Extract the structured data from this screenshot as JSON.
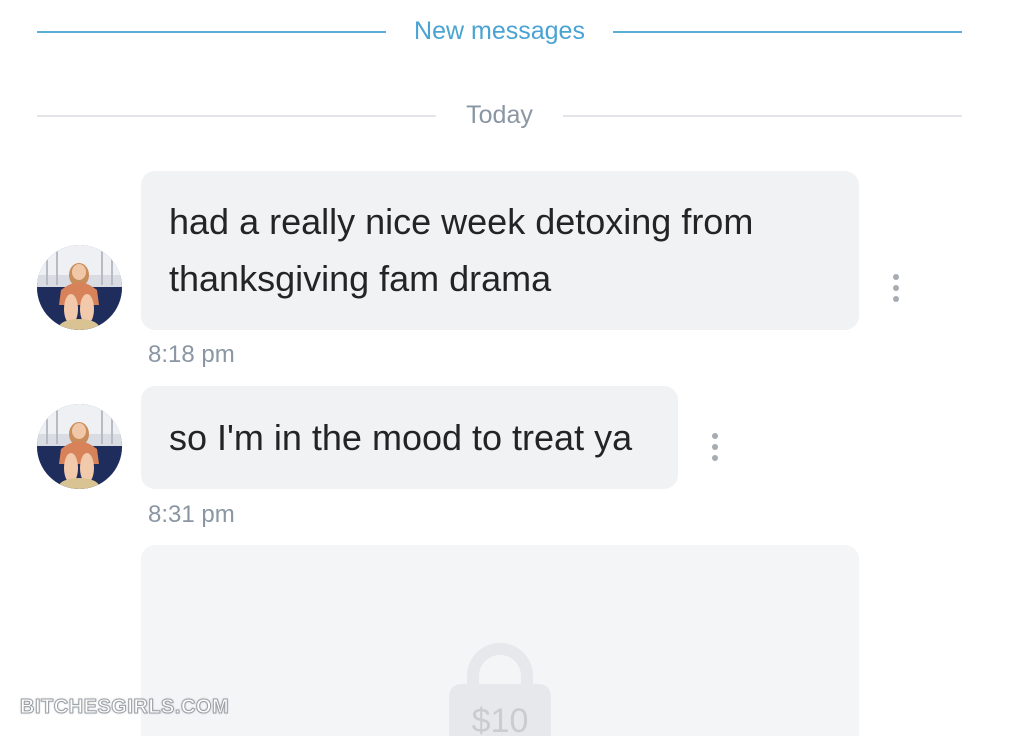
{
  "dividers": {
    "new_messages": "New messages",
    "today": "Today"
  },
  "messages": [
    {
      "text_line1": "had a really nice week detoxing from",
      "text_line2": "thanksgiving fam drama",
      "time": "8:18 pm"
    },
    {
      "text": "so I'm in the mood to treat ya",
      "time": "8:31 pm"
    }
  ],
  "locked_media": {
    "price": "$10"
  },
  "watermark": "BITCHESGIRLS.COM",
  "colors": {
    "accent": "#4aa3d2",
    "bubble": "#f1f2f4",
    "muted_text": "#8a96a3"
  },
  "icons": {
    "more": "more-vertical-icon",
    "lock": "lock-icon"
  }
}
